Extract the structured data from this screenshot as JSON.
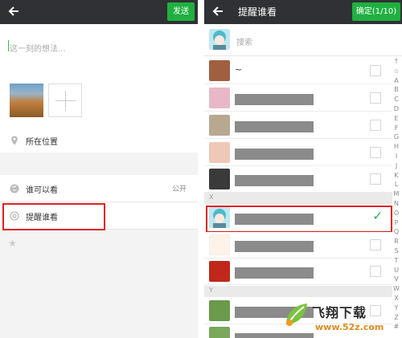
{
  "left": {
    "send_label": "发送",
    "compose_placeholder": "这一刻的想法...",
    "location_label": "所在位置",
    "visibility_label": "谁可以看",
    "visibility_value": "公开",
    "remind_label": "提醒谁看"
  },
  "right": {
    "title": "提醒谁看",
    "confirm_label": "确定(1/10)",
    "search_placeholder": "搜索",
    "first_contact_name": "~",
    "section_x": "X",
    "section_y": "Y",
    "alphabet": [
      "↑",
      "☆",
      "A",
      "B",
      "C",
      "D",
      "E",
      "F",
      "G",
      "H",
      "I",
      "J",
      "K",
      "L",
      "M",
      "N",
      "O",
      "P",
      "Q",
      "R",
      "S",
      "T",
      "U",
      "V",
      "W",
      "X",
      "Y",
      "Z",
      "#"
    ]
  },
  "watermark": {
    "brand": "飞翔下载",
    "url": "www.52z.com"
  },
  "colors": {
    "topbar": "#2f3134",
    "accent_green": "#20b040",
    "highlight_red": "#e0201e"
  }
}
